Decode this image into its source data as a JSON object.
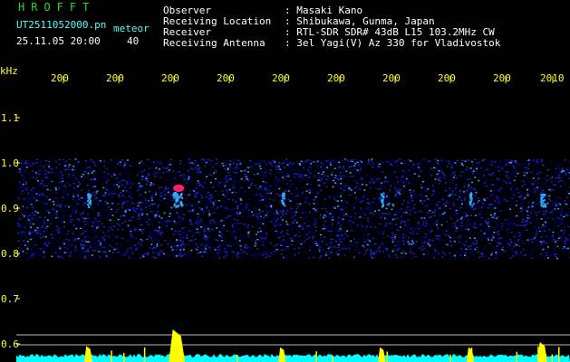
{
  "header": {
    "program": "HROFFT",
    "file_name": "UT2511052000.pn",
    "mode_label": "meteor",
    "datetime": "25.11.05 20:00",
    "count": "40"
  },
  "info": {
    "labels": [
      "Observer",
      "Receiving Location",
      "Receiver",
      "Receiving Antenna"
    ],
    "values": [
      ": Masaki Kano",
      ": Shibukawa, Gunma, Japan",
      ": RTL-SDR SDR# 43dB L15 103.2MHz CW",
      ": 3el Yagi(V) Az 330 for Vladivostok"
    ]
  },
  "chart_data": {
    "type": "heatmap",
    "ylabel": "kHz",
    "y_ticks": [
      "1.1",
      "1.0",
      "0.9",
      "0.8",
      "0.7",
      "0.6"
    ],
    "ylim": [
      0.58,
      1.16
    ],
    "x_ticks": [
      "200",
      "200",
      "200",
      "200",
      "200",
      "200",
      "200",
      "200",
      "200",
      "2010"
    ],
    "noise_band_khz": [
      0.79,
      1.01
    ],
    "signal_center_khz": 0.92,
    "meteor_echoes": [
      {
        "x_frac": 0.29,
        "strength": 1.0
      },
      {
        "x_frac": 0.13,
        "strength": 0.35
      },
      {
        "x_frac": 0.48,
        "strength": 0.3
      },
      {
        "x_frac": 0.66,
        "strength": 0.3
      },
      {
        "x_frac": 0.82,
        "strength": 0.3
      },
      {
        "x_frac": 0.95,
        "strength": 0.5
      }
    ],
    "colors": {
      "noise_dark": "#000066",
      "noise": "#2222cc",
      "noise_bright": "#33aaff",
      "echo_hot": "#ff2266",
      "profile": "#00ffff",
      "profile_spike": "#ffff00",
      "axis_text": "#ffff33",
      "grid_line": "#bbbbbb"
    }
  }
}
